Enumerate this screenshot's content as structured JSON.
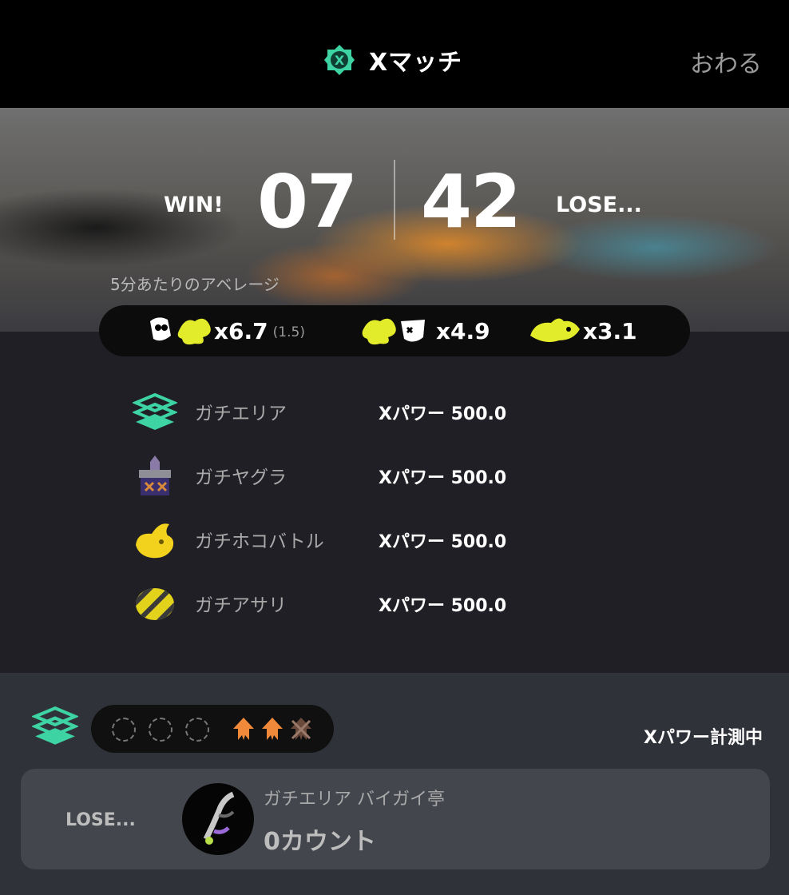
{
  "header": {
    "title": "Xマッチ",
    "end_label": "おわる"
  },
  "score": {
    "win_label": "WIN!",
    "win_value": "07",
    "lose_value": "42",
    "lose_label": "LOSE..."
  },
  "average": {
    "label": "5分あたりのアベレージ",
    "kills": "x6.7",
    "kills_assist": "(1.5)",
    "deaths": "x4.9",
    "specials": "x3.1"
  },
  "modes": [
    {
      "name": "ガチエリア",
      "power": "Xパワー 500.0",
      "icon": "splat-zones-icon"
    },
    {
      "name": "ガチヤグラ",
      "power": "Xパワー 500.0",
      "icon": "tower-control-icon"
    },
    {
      "name": "ガチホコバトル",
      "power": "Xパワー 500.0",
      "icon": "rainmaker-icon"
    },
    {
      "name": "ガチアサリ",
      "power": "Xパワー 500.0",
      "icon": "clam-blitz-icon"
    }
  ],
  "series": {
    "status": "Xパワー計測中",
    "empty_slots": 3,
    "wins": 2,
    "losses": 1
  },
  "last_battle": {
    "result": "LOSE...",
    "stage": "ガチエリア バイガイ亭",
    "count": "0カウント"
  },
  "colors": {
    "accent_green": "#3ed3a3",
    "accent_yellow": "#e3ec2a",
    "orange": "#f08a3a"
  }
}
